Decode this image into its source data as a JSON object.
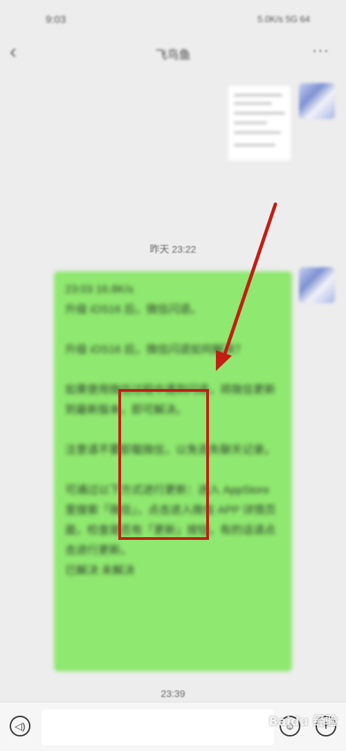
{
  "status_bar": {
    "time": "9:03",
    "icons": "5.0K/s 5G 64"
  },
  "header": {
    "back_icon": "‹",
    "title": "飞鸟鱼",
    "more_icon": "···"
  },
  "messages": {
    "image_message": {
      "icon": "image-thumbnail"
    },
    "timestamp_1": "昨天 23:22",
    "text_bubble": "23:03 16.8K/s\n升级 iOS16 后，微信闪退。\n\n升级 iOS16 后，微信闪退如何解决？\n\n如果使用微信过程中遇到闪退，将微信更新到最新版本，即可解决。\n\n注意请不要卸载微信，以免丢失聊天记录。\n\n可通过以下方式进行更新：进入 AppStore 里搜索「微信」，点击进入微信 APP 详情页面，检查是否有「更新」按钮，有的话请点击进行更新。\n已解决 未解决",
    "timestamp_2": "23:39"
  },
  "input_bar": {
    "voice_icon": "voice-icon",
    "emoji_icon": "emoji-icon",
    "plus_icon": "plus-icon"
  },
  "watermark": "Baidu 经验",
  "colors": {
    "bubble": "#8fe86f",
    "annotation": "#c21e14",
    "background": "#ededed"
  }
}
